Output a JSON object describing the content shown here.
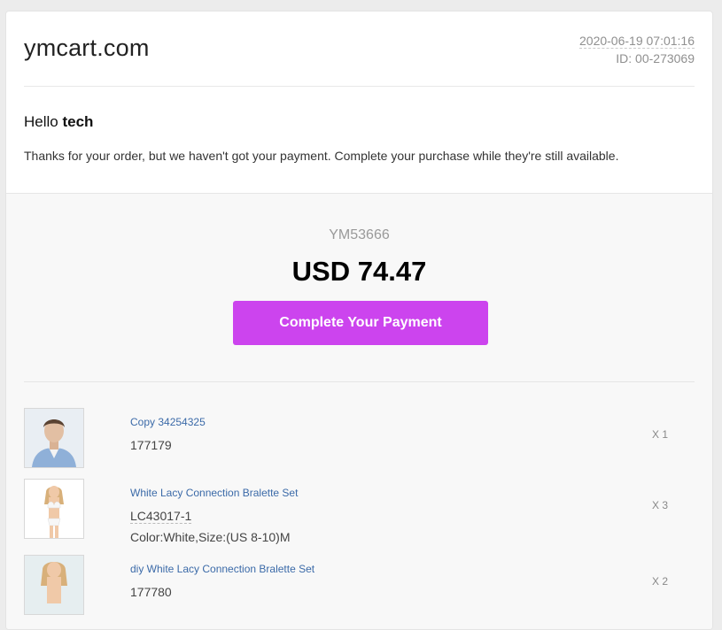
{
  "header": {
    "site_title": "ymcart.com",
    "datetime": "2020-06-19 07:01:16",
    "id_label": "ID: 00-273069"
  },
  "greeting": {
    "hello": "Hello",
    "name": "tech"
  },
  "message": "Thanks for your order, but we haven't got your payment. Complete your purchase while they're still available.",
  "order": {
    "number": "YM53666",
    "total": "USD 74.47",
    "pay_button": "Complete Your Payment"
  },
  "items": [
    {
      "name": "Copy 34254325",
      "sku": "177179",
      "attributes": "",
      "quantity": "X 1",
      "thumbnail": "man-in-blue-shirt-photo"
    },
    {
      "name": "White Lacy Connection Bralette Set",
      "sku": "LC43017-1",
      "attributes": "Color:White,Size:(US 8-10)M",
      "quantity": "X 3",
      "thumbnail": "white-lingerie-photo"
    },
    {
      "name": "diy White Lacy Connection Bralette Set",
      "sku": "177780",
      "attributes": "",
      "quantity": "X 2",
      "thumbnail": "white-lingerie-photo"
    }
  ],
  "colors": {
    "accent": "#cc44ee",
    "link": "#3b6aa8",
    "background": "#ececec"
  }
}
